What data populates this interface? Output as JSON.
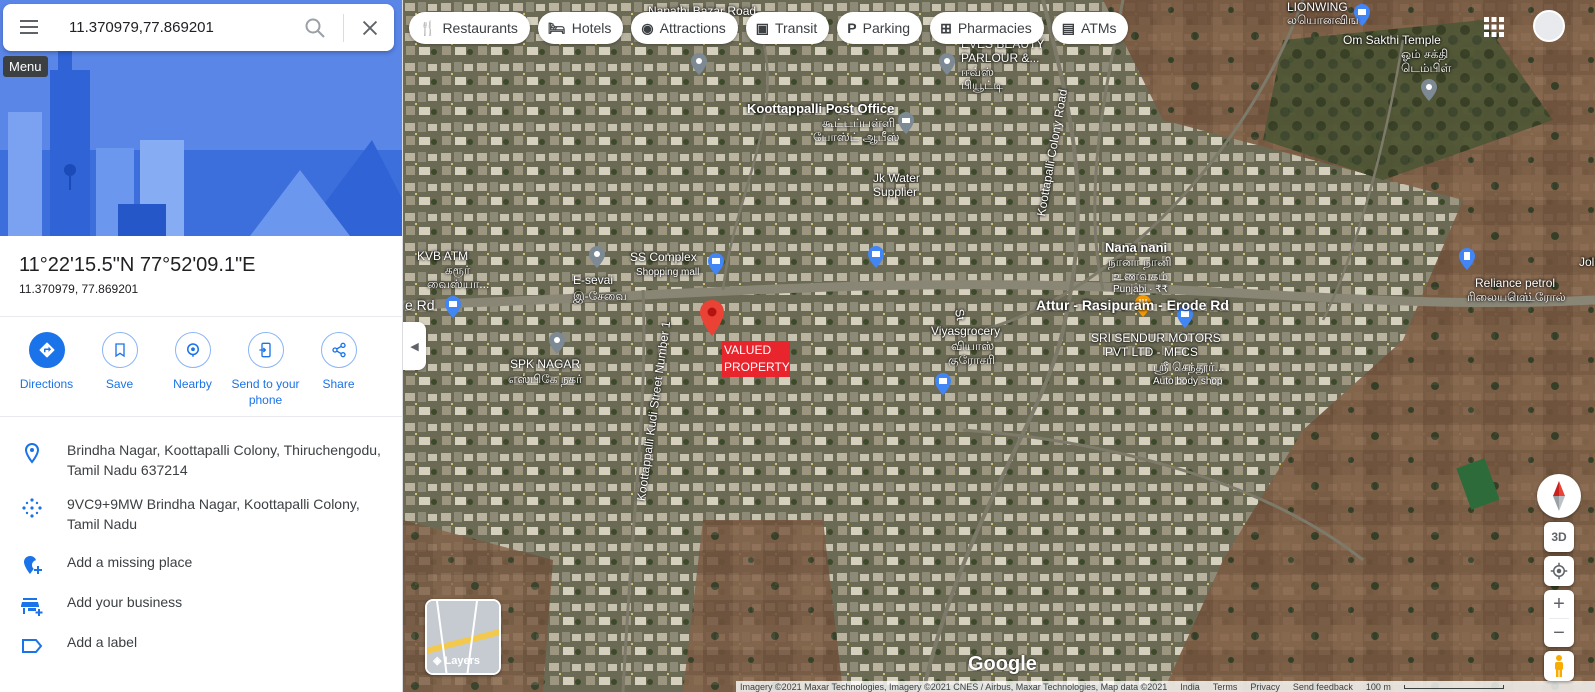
{
  "search": {
    "value": "11.370979,77.869201"
  },
  "tooltip": {
    "menu": "Menu"
  },
  "place": {
    "coords_dms": "11°22'15.5\"N 77°52'09.1\"E",
    "coords_decimal": "11.370979, 77.869201"
  },
  "actions": [
    {
      "label": "Directions",
      "icon": "directions-icon"
    },
    {
      "label": "Save",
      "icon": "bookmark-icon"
    },
    {
      "label": "Nearby",
      "icon": "nearby-icon"
    },
    {
      "label": "Send to your phone",
      "icon": "phone-icon"
    },
    {
      "label": "Share",
      "icon": "share-icon"
    }
  ],
  "info": {
    "address": "Brindha Nagar, Koottapalli Colony, Thiruchengodu, Tamil Nadu 637214",
    "plus_code": "9VC9+9MW Brindha Nagar, Koottapalli Colony, Tamil Nadu",
    "add_missing": "Add a missing place",
    "add_business": "Add your business",
    "add_label": "Add a label"
  },
  "chips": [
    {
      "label": "Restaurants",
      "icon": "fork-knife-icon"
    },
    {
      "label": "Hotels",
      "icon": "bed-icon"
    },
    {
      "label": "Attractions",
      "icon": "camera-icon"
    },
    {
      "label": "Transit",
      "icon": "train-icon"
    },
    {
      "label": "Parking",
      "icon": "parking-icon"
    },
    {
      "label": "Pharmacies",
      "icon": "pharmacy-icon"
    },
    {
      "label": "ATMs",
      "icon": "atm-icon"
    }
  ],
  "map_labels": {
    "lionwing": "LIONWING",
    "lionwing_ta": "லயொனவிங",
    "om_sakthi": "Om Sakthi Temple",
    "om_sakthi_ta1": "ஓம் சக்தி",
    "om_sakthi_ta2": "டெம்பிள்",
    "eves": "EVES BEAUTY",
    "eves2": "PARLOUR &...",
    "eves_ta": "ஈவ்ஸ்",
    "eves_ta2": "பியூட்டி",
    "post_office": "Koottappalli Post Office",
    "post_office_ta1": "கூட்டப்பள்ளி",
    "post_office_ta2": "போஸ்ட் ஆபீஸ்",
    "jk_water": "Jk Water",
    "jk_water2": "Supplier",
    "colony_road": "Koottapalli Colony Road",
    "kvb_atm": "KVB ATM",
    "kvb_ta1": "கரூர்",
    "kvb_ta2": "வைஸ்யா...",
    "e_sevai": "E-sevai",
    "e_sevai_ta": "இ-சேவை",
    "ss_complex": "SS Complex",
    "ss_complex_sub": "Shopping mall",
    "nana_nani": "Nana nani",
    "nana_ta1": "நானா நானி",
    "nana_ta2": "உணவகம்",
    "nana_sub": "Punjabi · ₹₹",
    "attur_road": "Attur - Rasipuram - Erode Rd",
    "reliance": "Reliance petrol",
    "reliance_ta": "ரிலையன்ஸ்",
    "reliance_ta2": "பெட்ரோல்",
    "jolly": "Jolly",
    "e_rd": "e Rd",
    "spk_nagar": "SPK NAGAR",
    "spk_ta": "எஸ்பிகே நகர்",
    "street_no1": "Koottappalli Kudi Street Number 1",
    "viyas": "Viyasgrocery",
    "viyas_ta1": "வியாஸ்",
    "viyas_ta2": "குரோசரி",
    "st": "St",
    "sri_sendur": "SRI SENDUR MOTORS",
    "sri_sendur2": "PVT LTD - MFCS",
    "sri_sendur_ta": "ஸ்ரீ செந்தூர்...",
    "sri_sendur_sub": "Auto body shop",
    "valued_property": "VALUED PROPERTY",
    "top_road": "Nanathi Bazar Road"
  },
  "layers_label": "Layers",
  "google_logo": "Google",
  "controls": {
    "three_d": "3D"
  },
  "attribution": {
    "imagery": "Imagery ©2021 Maxar Technologies, Imagery ©2021 CNES / Airbus, Maxar Technologies, Map data ©2021",
    "india": "India",
    "terms": "Terms",
    "privacy": "Privacy",
    "feedback": "Send feedback",
    "scale": "100 m"
  }
}
